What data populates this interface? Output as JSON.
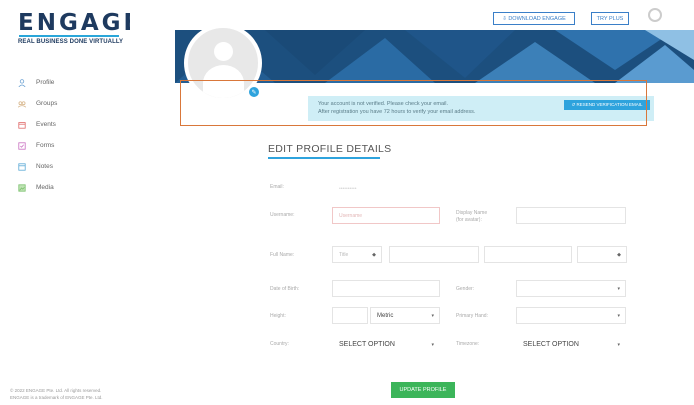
{
  "brand": {
    "logo": "ENGAGE",
    "tagline": "REAL BUSINESS DONE VIRTUALLY"
  },
  "sidebar": {
    "items": [
      {
        "label": "Profile",
        "icon": "user-icon",
        "color": "#6fa3d3"
      },
      {
        "label": "Groups",
        "icon": "groups-icon",
        "color": "#d7b58a"
      },
      {
        "label": "Events",
        "icon": "calendar-icon",
        "color": "#e06a6a"
      },
      {
        "label": "Forms",
        "icon": "forms-icon",
        "color": "#c86ec0"
      },
      {
        "label": "Notes",
        "icon": "notes-icon",
        "color": "#5aa9d6"
      },
      {
        "label": "Media",
        "icon": "media-icon",
        "color": "#7cc16e"
      }
    ],
    "footer_line1": "© 2022 ENGAGE Pte. Ltd. All rights reserved.",
    "footer_line2": "ENGAGE is a trademark of ENGAGE Pte. Ltd."
  },
  "topbar": {
    "download_label": "⇩ DOWNLOAD ENGAGE",
    "try_plus_label": "TRY PLUS"
  },
  "notice": {
    "line1": "Your account is not verified. Please check your email.",
    "line2": "After registration you have 72 hours to verify your email address.",
    "resend_label": "↺ RESEND VERIFICATION EMAIL"
  },
  "form": {
    "title": "EDIT PROFILE DETAILS",
    "email_label": "Email:",
    "username_label": "Username:",
    "username_placeholder": "Username",
    "display_name_label": "Display Name",
    "display_name_sub": "(for avatar):",
    "fullname_label": "Full Name:",
    "title_placeholder": "Title",
    "dob_label": "Date of Birth:",
    "gender_label": "Gender:",
    "height_label": "Height:",
    "height_unit": "Metric",
    "primary_hand_label": "Primary Hand:",
    "country_label": "Country:",
    "country_value": "SELECT OPTION",
    "timezone_label": "Timezone:",
    "timezone_value": "SELECT OPTION",
    "update_label": "UPDATE PROFILE"
  },
  "colors": {
    "accent": "#2ea3dd",
    "brand_navy": "#1e3a5f",
    "banner": "#1c4f7e",
    "notice_bg": "#cfeef6",
    "update_button": "#3cb55a",
    "highlight_box": "#d9773a"
  }
}
